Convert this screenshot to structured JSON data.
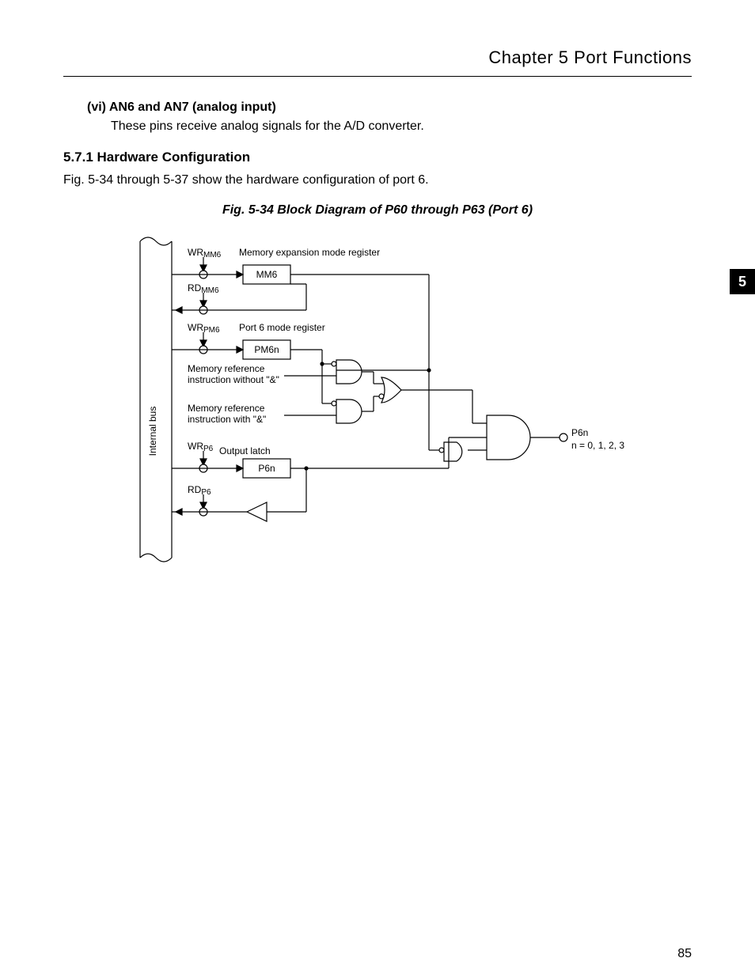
{
  "header": {
    "chapter_title": "Chapter 5   Port Functions"
  },
  "page_tab": "5",
  "page_number": "85",
  "content": {
    "sub_item_title": "(vi) AN6 and AN7 (analog input)",
    "sub_item_text": "These pins receive analog signals for the A/D converter.",
    "section_number_title": "5.7.1  Hardware Configuration",
    "section_intro": "Fig. 5-34 through 5-37 show the hardware configuration of port 6.",
    "figure_caption": "Fig. 5-34  Block Diagram of P60 through P63 (Port 6)"
  },
  "diagram": {
    "bus_label": "Internal bus",
    "sig_wr_mm6": "WR",
    "sig_wr_mm6_sub": "MM6",
    "sig_rd_mm6": "RD",
    "sig_rd_mm6_sub": "MM6",
    "sig_wr_pm6": "WR",
    "sig_wr_pm6_sub": "PM6",
    "sig_wr_p6": "WR",
    "sig_wr_p6_sub": "P6",
    "sig_rd_p6": "RD",
    "sig_rd_p6_sub": "P6",
    "reg_mm6_desc": "Memory expansion mode register",
    "reg_mm6": "MM6",
    "reg_pm6_desc": "Port 6 mode register",
    "reg_pm6": "PM6n",
    "mem_ref_without": "Memory reference instruction without \"&\"",
    "mem_ref_with": "Memory reference instruction with \"&\"",
    "output_latch": "Output latch",
    "reg_p6n": "P6n",
    "pin_label": "P6n",
    "pin_note": "n = 0, 1, 2, 3"
  }
}
